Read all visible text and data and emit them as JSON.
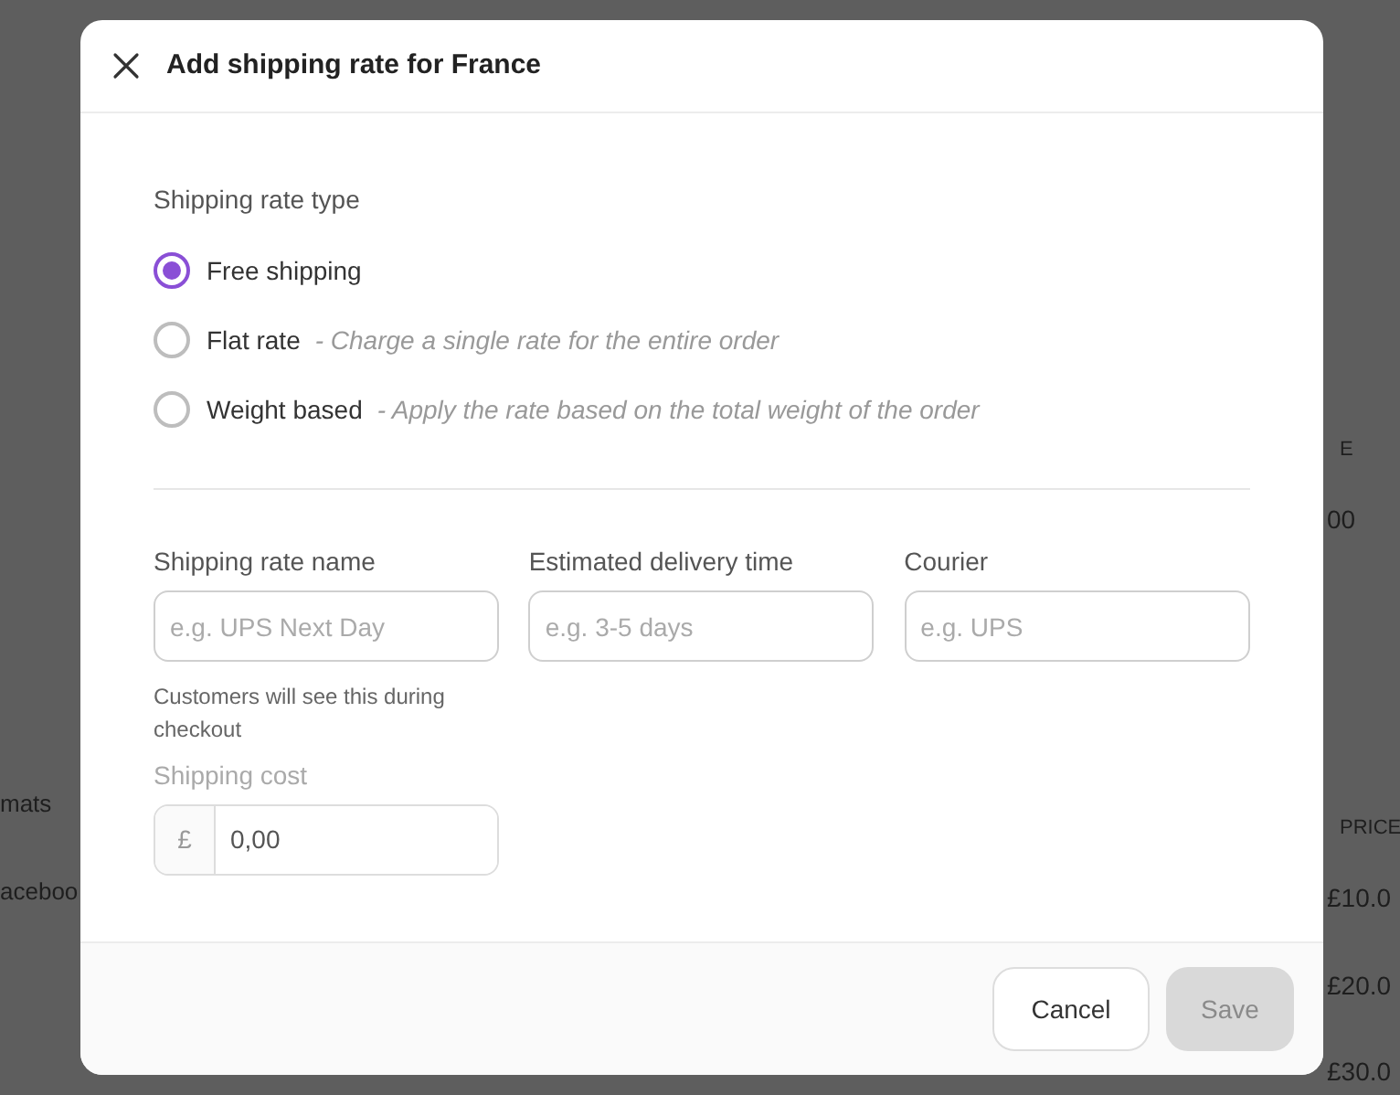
{
  "background": {
    "left_texts": [
      "mats",
      "aceboo"
    ],
    "right_texts": [
      {
        "text": "E",
        "kind": "heading"
      },
      {
        "text": "00",
        "kind": "cell"
      },
      {
        "text": "PRICE",
        "kind": "heading"
      },
      {
        "text": "£10.0",
        "kind": "cell"
      },
      {
        "text": "£20.0",
        "kind": "cell"
      },
      {
        "text": "£30.0",
        "kind": "cell"
      }
    ]
  },
  "dialog": {
    "title": "Add shipping rate for France",
    "rate_type": {
      "label": "Shipping rate type",
      "options": [
        {
          "label": "Free shipping",
          "selected": true
        },
        {
          "label": "Flat rate",
          "description": "- Charge a single rate for the entire order",
          "selected": false
        },
        {
          "label": "Weight based",
          "description": "- Apply the rate based on the total weight of the order",
          "selected": false
        }
      ]
    },
    "fields": [
      {
        "label": "Shipping rate name",
        "placeholder": "e.g. UPS Next Day",
        "helper": "Customers will see this during checkout"
      },
      {
        "label": "Estimated delivery time",
        "placeholder": "e.g. 3-5 days"
      },
      {
        "label": "Courier",
        "placeholder": "e.g. UPS"
      }
    ],
    "shipping_cost": {
      "label": "Shipping cost",
      "currency": "£",
      "value": "0,00",
      "disabled": true
    },
    "buttons": [
      {
        "label": "Cancel",
        "kind": "secondary",
        "disabled": false
      },
      {
        "label": "Save",
        "kind": "primary",
        "disabled": true
      }
    ]
  }
}
